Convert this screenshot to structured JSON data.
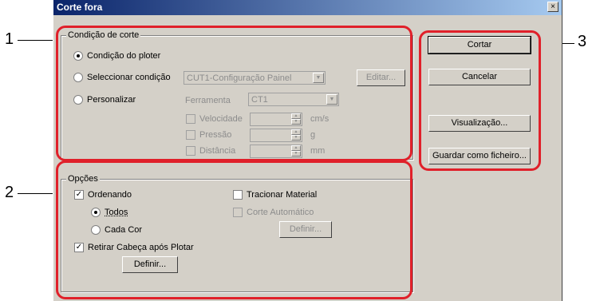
{
  "window": {
    "title": "Corte fora",
    "close_glyph": "×"
  },
  "condicao": {
    "group_label": "Condição de corte",
    "radio_ploter": "Condição do ploter",
    "radio_seleccionar": "Seleccionar condição",
    "radio_personalizar": "Personalizar",
    "condition_combo_value": "CUT1-Configuração Painel",
    "edit_button": "Editar...",
    "ferramenta_label": "Ferramenta",
    "ferramenta_value": "CT1",
    "velocidade_label": "Velocidade",
    "velocidade_unit": "cm/s",
    "pressao_label": "Pressão",
    "pressao_unit": "g",
    "distancia_label": "Distância",
    "distancia_unit": "mm",
    "selected": "Condição do ploter"
  },
  "opcoes": {
    "group_label": "Opções",
    "ordenando": "Ordenando",
    "ordenando_checked": true,
    "todos": "Todos",
    "cada_cor": "Cada Cor",
    "retirar": "Retirar Cabeça após Plotar",
    "retirar_checked": true,
    "definir_left": "Definir...",
    "tracionar": "Tracionar Material",
    "tracionar_checked": false,
    "corte_auto": "Corte Automático",
    "definir_right": "Definir..."
  },
  "actions": {
    "cortar": "Cortar",
    "cancelar": "Cancelar",
    "visualizacao": "Visualização...",
    "guardar": "Guardar como ficheiro..."
  },
  "callouts": {
    "one": "1",
    "two": "2",
    "three": "3"
  },
  "colors": {
    "callout": "#e0202a",
    "titlebar": "#0a246a"
  }
}
